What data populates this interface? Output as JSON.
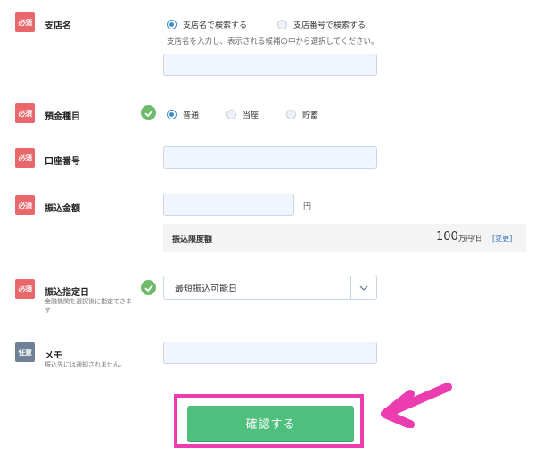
{
  "badges": {
    "required": "必須",
    "optional": "任意"
  },
  "branch": {
    "label": "支店名",
    "radio_name": "支店名で検索する",
    "radio_code": "支店番号で検索する",
    "hint": "支店名を入力し、表示される候補の中から選択してください。"
  },
  "account_type": {
    "label": "預金種目",
    "options": [
      "普通",
      "当座",
      "貯蓄"
    ],
    "selected": "普通"
  },
  "account_number": {
    "label": "口座番号"
  },
  "amount": {
    "label": "振込金額",
    "unit": "円",
    "limit_label": "振込限度額",
    "limit_value": "100",
    "limit_unit": "万円/日",
    "change_link": "[変更]"
  },
  "transfer_date": {
    "label": "振込指定日",
    "sublabel": "金融機関を選択後に指定できます",
    "selected": "最短振込可能日"
  },
  "memo": {
    "label": "メモ",
    "sublabel": "振込先には通知されません。"
  },
  "confirm": {
    "label": "確認する"
  },
  "colors": {
    "accent": "#4fbf7d",
    "required": "#e8676a",
    "optional": "#6f8197",
    "highlight": "#ec3db0"
  }
}
